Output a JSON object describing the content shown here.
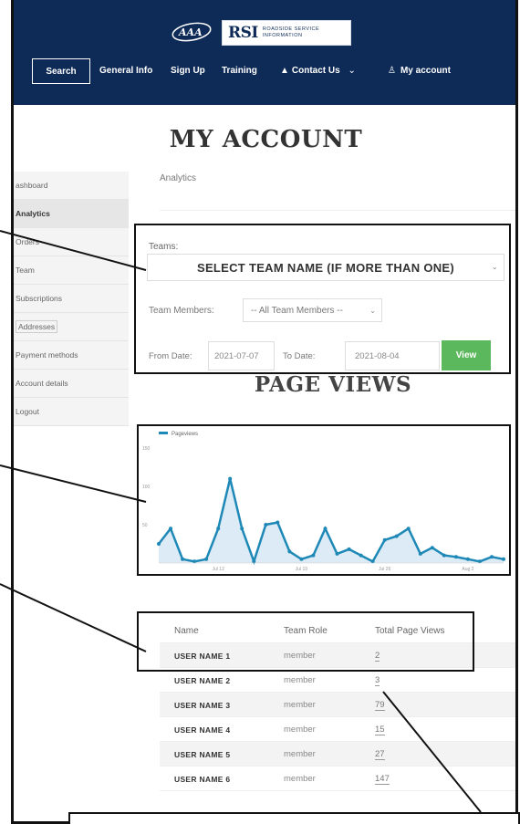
{
  "header": {
    "brand": "RSI",
    "brand_sub_1": "ROADSIDE SERVICE",
    "brand_sub_2": "INFORMATION",
    "nav": {
      "search": "Search",
      "general_info": "General Info",
      "sign_up": "Sign Up",
      "training": "Training",
      "contact_us": "Contact Us",
      "my_account": "My account"
    }
  },
  "page_title": "MY ACCOUNT",
  "sidebar": {
    "items": [
      {
        "label": "ashboard"
      },
      {
        "label": "Analytics",
        "active": true
      },
      {
        "label": "Orders"
      },
      {
        "label": "Team"
      },
      {
        "label": "Subscriptions"
      },
      {
        "label": "Addresses"
      },
      {
        "label": "Payment methods"
      },
      {
        "label": "Account details"
      },
      {
        "label": "Logout"
      }
    ]
  },
  "section_label": "Analytics",
  "filters": {
    "teams_label": "Teams:",
    "team_selected": "SELECT TEAM NAME (IF MORE THAN ONE)",
    "members_label": "Team Members:",
    "member_selected": "-- All Team Members --",
    "from_label": "From Date:",
    "from_value": "2021-07-07",
    "to_label": "To Date:",
    "to_value": "2021-08-04",
    "view_label": "View"
  },
  "page_views_title": "PAGE VIEWS",
  "chart_data": {
    "type": "area",
    "legend": [
      "Pageviews"
    ],
    "colors": {
      "line": "#1e88b6",
      "fill": "#dcebf5"
    },
    "ytick_labels": [
      "150",
      "100",
      "50"
    ],
    "xtick_labels": [
      "Jul 12",
      "Jul 19",
      "Jul 26",
      "Aug 2"
    ],
    "ylim": [
      0,
      150
    ],
    "values": [
      25,
      45,
      5,
      2,
      5,
      45,
      110,
      45,
      2,
      50,
      53,
      15,
      5,
      10,
      45,
      12,
      18,
      10,
      2,
      30,
      35,
      45,
      12,
      20,
      10,
      8,
      5,
      2,
      8,
      5
    ]
  },
  "table": {
    "headers": [
      "Name",
      "Team Role",
      "Total Page Views"
    ],
    "rows": [
      {
        "name": "USER NAME 1",
        "role": "member",
        "views": "2"
      },
      {
        "name": "USER NAME 2",
        "role": "member",
        "views": "3"
      },
      {
        "name": "USER NAME 3",
        "role": "member",
        "views": "79"
      },
      {
        "name": "USER NAME 4",
        "role": "member",
        "views": "15"
      },
      {
        "name": "USER NAME 5",
        "role": "member",
        "views": "27"
      },
      {
        "name": "USER NAME 6",
        "role": "member",
        "views": "147"
      }
    ]
  }
}
